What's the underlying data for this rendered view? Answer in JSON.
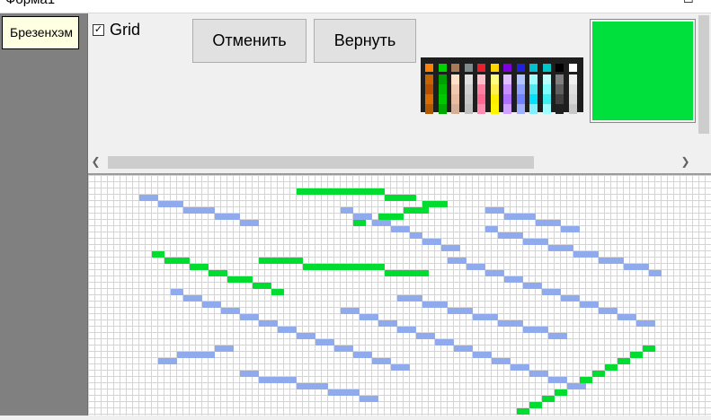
{
  "window": {
    "title": "Форма1",
    "controls": [
      "–",
      "☐"
    ]
  },
  "sidebar": {
    "algorithm_button": "Брезенхэм"
  },
  "toolbar": {
    "grid_label": "Grid",
    "grid_checked": true,
    "grid_check_mark": "✓",
    "undo_label": "Отменить",
    "redo_label": "Вернуть"
  },
  "palette": {
    "columns": [
      [
        "#ff8000",
        "#c86400",
        "#b45000",
        "#d86d00",
        "#b35900"
      ],
      [
        "#00d200",
        "#00a000",
        "#00b800",
        "#00c800",
        "#00a800"
      ],
      [
        "#a87a5c",
        "#ffe0c8",
        "#f0c8b0",
        "#e8bca0",
        "#d4b098"
      ],
      [
        "#7f8c8d",
        "#e0e0e0",
        "#d0d0d0",
        "#c8c8c8",
        "#bfbfbf"
      ],
      [
        "#e8202c",
        "#ffc0cb",
        "#ff80a0",
        "#ff6690",
        "#ff8cb0"
      ],
      [
        "#ffd700",
        "#ffff80",
        "#fff050",
        "#ffee00",
        "#fff500"
      ],
      [
        "#8000e0",
        "#e0c0ff",
        "#c890ff",
        "#b070ff",
        "#d0a0ff"
      ],
      [
        "#2020e0",
        "#b0c4ff",
        "#8da0ff",
        "#7080ff",
        "#a0b0ff"
      ],
      [
        "#00c0d0",
        "#a0ffff",
        "#50e8f0",
        "#00e0ff",
        "#80f0ff"
      ],
      [
        "#00c8c8",
        "#c0ffff",
        "#80ffff",
        "#40f0f0",
        "#a0ffff"
      ],
      [
        "#000000",
        "#808080",
        "#606060",
        "#404040",
        "#202020"
      ],
      [
        "#ffffff",
        "#f0f0f0",
        "#e0e0e0",
        "#d8d8d8",
        "#c8c8c8"
      ]
    ]
  },
  "current_color": "#00e03c",
  "canvas": {
    "cell_size": 7,
    "grid_color": "#d4d4d4",
    "lines": [
      {
        "color": "#00dc30",
        "segments": [
          [
            47,
            3,
            5
          ],
          [
            38,
            2,
            9
          ],
          [
            33,
            2,
            5
          ]
        ]
      },
      {
        "color": "#00dc30",
        "segments": [
          [
            53,
            4,
            4
          ],
          [
            50,
            5,
            4
          ],
          [
            46,
            6,
            4
          ],
          [
            42,
            7,
            2
          ]
        ]
      },
      {
        "color": "#00dc30",
        "segments": [
          [
            10,
            12,
            2
          ],
          [
            12,
            13,
            4
          ],
          [
            16,
            14,
            3
          ],
          [
            19,
            15,
            3
          ],
          [
            22,
            16,
            4
          ],
          [
            26,
            17,
            3
          ],
          [
            29,
            18,
            2
          ]
        ]
      },
      {
        "color": "#00dc30",
        "segments": [
          [
            27,
            13,
            7
          ],
          [
            34,
            14,
            13
          ],
          [
            47,
            15,
            7
          ]
        ]
      },
      {
        "color": "#00dc30",
        "segments": [
          [
            88,
            27,
            2
          ],
          [
            86,
            28,
            2
          ],
          [
            84,
            29,
            2
          ],
          [
            82,
            30,
            2
          ],
          [
            80,
            31,
            2
          ],
          [
            78,
            32,
            2
          ],
          [
            76,
            33,
            2
          ],
          [
            74,
            34,
            2
          ],
          [
            72,
            35,
            2
          ],
          [
            70,
            36,
            2
          ],
          [
            68,
            37,
            2
          ]
        ]
      },
      {
        "color": "#90aaee",
        "segments": [
          [
            8,
            3,
            3
          ],
          [
            11,
            4,
            4
          ],
          [
            15,
            5,
            5
          ],
          [
            20,
            6,
            4
          ],
          [
            24,
            7,
            3
          ]
        ]
      },
      {
        "color": "#90aaee",
        "segments": [
          [
            40,
            5,
            2
          ],
          [
            42,
            6,
            3
          ],
          [
            45,
            7,
            3
          ],
          [
            48,
            8,
            3
          ],
          [
            51,
            9,
            2
          ],
          [
            53,
            10,
            3
          ],
          [
            56,
            11,
            3
          ]
        ]
      },
      {
        "color": "#90aaee",
        "segments": [
          [
            63,
            5,
            3
          ],
          [
            66,
            6,
            5
          ],
          [
            71,
            7,
            4
          ],
          [
            75,
            8,
            3
          ]
        ]
      },
      {
        "color": "#90aaee",
        "segments": [
          [
            63,
            8,
            2
          ],
          [
            65,
            9,
            4
          ],
          [
            69,
            10,
            4
          ],
          [
            73,
            11,
            4
          ],
          [
            77,
            12,
            4
          ],
          [
            81,
            13,
            4
          ],
          [
            85,
            14,
            4
          ],
          [
            89,
            15,
            2
          ]
        ]
      },
      {
        "color": "#90aaee",
        "segments": [
          [
            57,
            13,
            3
          ],
          [
            60,
            14,
            3
          ],
          [
            63,
            15,
            3
          ],
          [
            66,
            16,
            3
          ],
          [
            69,
            17,
            3
          ],
          [
            72,
            18,
            3
          ],
          [
            75,
            19,
            3
          ],
          [
            78,
            20,
            3
          ],
          [
            81,
            21,
            3
          ],
          [
            84,
            22,
            3
          ],
          [
            87,
            23,
            3
          ]
        ]
      },
      {
        "color": "#90aaee",
        "segments": [
          [
            13,
            18,
            2
          ],
          [
            15,
            19,
            3
          ],
          [
            18,
            20,
            3
          ],
          [
            21,
            21,
            3
          ],
          [
            24,
            22,
            3
          ],
          [
            27,
            23,
            3
          ],
          [
            30,
            24,
            3
          ],
          [
            33,
            25,
            3
          ],
          [
            36,
            26,
            3
          ],
          [
            39,
            27,
            3
          ],
          [
            42,
            28,
            3
          ],
          [
            45,
            29,
            3
          ],
          [
            48,
            30,
            3
          ]
        ]
      },
      {
        "color": "#90aaee",
        "segments": [
          [
            40,
            21,
            3
          ],
          [
            43,
            22,
            3
          ],
          [
            46,
            23,
            3
          ],
          [
            49,
            24,
            3
          ],
          [
            52,
            25,
            3
          ],
          [
            55,
            26,
            3
          ],
          [
            58,
            27,
            3
          ],
          [
            61,
            28,
            3
          ],
          [
            64,
            29,
            3
          ],
          [
            67,
            30,
            3
          ],
          [
            70,
            31,
            3
          ],
          [
            73,
            32,
            3
          ],
          [
            76,
            33,
            3
          ]
        ]
      },
      {
        "color": "#90aaee",
        "segments": [
          [
            49,
            19,
            4
          ],
          [
            53,
            20,
            4
          ],
          [
            57,
            21,
            4
          ],
          [
            61,
            22,
            4
          ],
          [
            65,
            23,
            4
          ],
          [
            69,
            24,
            4
          ],
          [
            73,
            25,
            3
          ]
        ]
      },
      {
        "color": "#90aaee",
        "segments": [
          [
            11,
            29,
            3
          ],
          [
            14,
            28,
            6
          ],
          [
            20,
            27,
            3
          ]
        ]
      },
      {
        "color": "#90aaee",
        "segments": [
          [
            24,
            31,
            3
          ],
          [
            27,
            32,
            6
          ],
          [
            33,
            33,
            5
          ],
          [
            38,
            34,
            5
          ],
          [
            43,
            35,
            3
          ]
        ]
      }
    ]
  }
}
